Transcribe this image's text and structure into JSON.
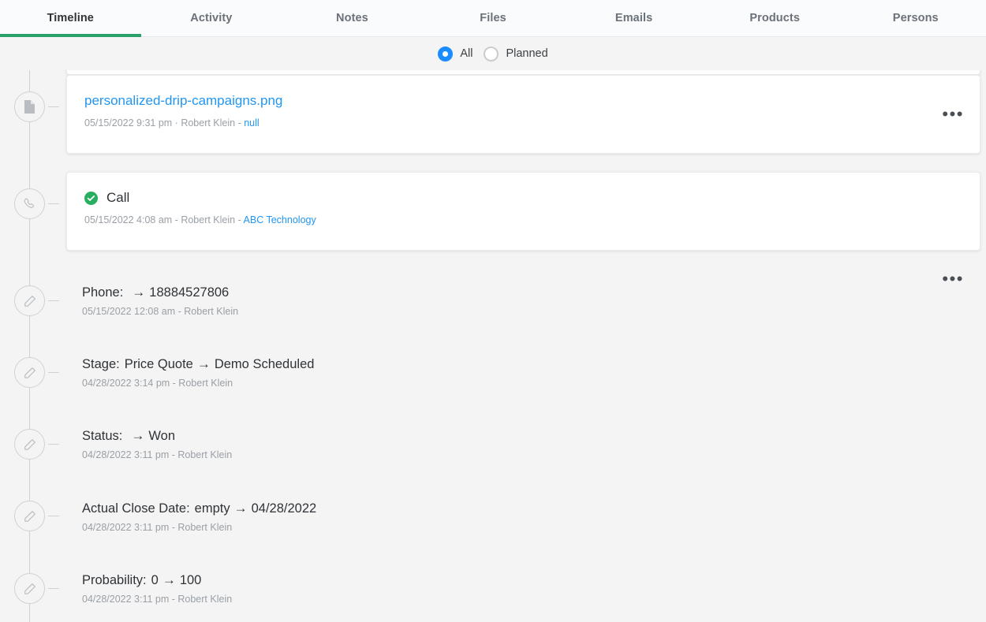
{
  "tabs": [
    {
      "label": "Timeline",
      "active": true
    },
    {
      "label": "Activity",
      "active": false
    },
    {
      "label": "Notes",
      "active": false
    },
    {
      "label": "Files",
      "active": false
    },
    {
      "label": "Emails",
      "active": false
    },
    {
      "label": "Products",
      "active": false
    },
    {
      "label": "Persons",
      "active": false
    }
  ],
  "filter": {
    "options": [
      {
        "label": "All",
        "selected": true
      },
      {
        "label": "Planned",
        "selected": false
      }
    ]
  },
  "colors": {
    "active_tab_underline": "#27a06a",
    "link": "#2196f3",
    "radio_selected": "#1a8cff",
    "success_badge": "#27ae60",
    "page_background": "#f4f4f4"
  },
  "timeline": {
    "file_entry": {
      "icon": "file-icon",
      "title": "personalized-drip-campaigns.png",
      "meta_date": "05/15/2022 9:31 pm",
      "meta_separator": " · ",
      "meta_user": "Robert Klein",
      "meta_dash": " - ",
      "meta_link": "null",
      "menu": "•••"
    },
    "call_entry": {
      "icon": "phone-icon",
      "title": "Call",
      "status_icon": "check-circle-icon",
      "meta_date": "05/15/2022 4:08 am",
      "meta_dash1": " - ",
      "meta_user": "Robert Klein",
      "meta_dash2": " - ",
      "meta_link": "ABC Technology",
      "menu": "•••"
    },
    "changes": [
      {
        "icon": "pencil-icon",
        "field": "Phone:",
        "from": "",
        "arrow": "→",
        "to": "18884527806",
        "meta": "05/15/2022 12:08 am - Robert Klein"
      },
      {
        "icon": "pencil-icon",
        "field": "Stage:",
        "from": "Price Quote",
        "arrow": "→",
        "to": "Demo Scheduled",
        "meta": "04/28/2022 3:14 pm - Robert Klein"
      },
      {
        "icon": "pencil-icon",
        "field": "Status:",
        "from": "",
        "arrow": "→",
        "to": "Won",
        "meta": "04/28/2022 3:11 pm - Robert Klein"
      },
      {
        "icon": "pencil-icon",
        "field": "Actual Close Date:",
        "from": "empty",
        "arrow": "→",
        "to": "04/28/2022",
        "meta": "04/28/2022 3:11 pm - Robert Klein"
      },
      {
        "icon": "pencil-icon",
        "field": "Probability:",
        "from": "0",
        "arrow": "→",
        "to": "100",
        "meta": "04/28/2022 3:11 pm - Robert Klein"
      }
    ]
  }
}
